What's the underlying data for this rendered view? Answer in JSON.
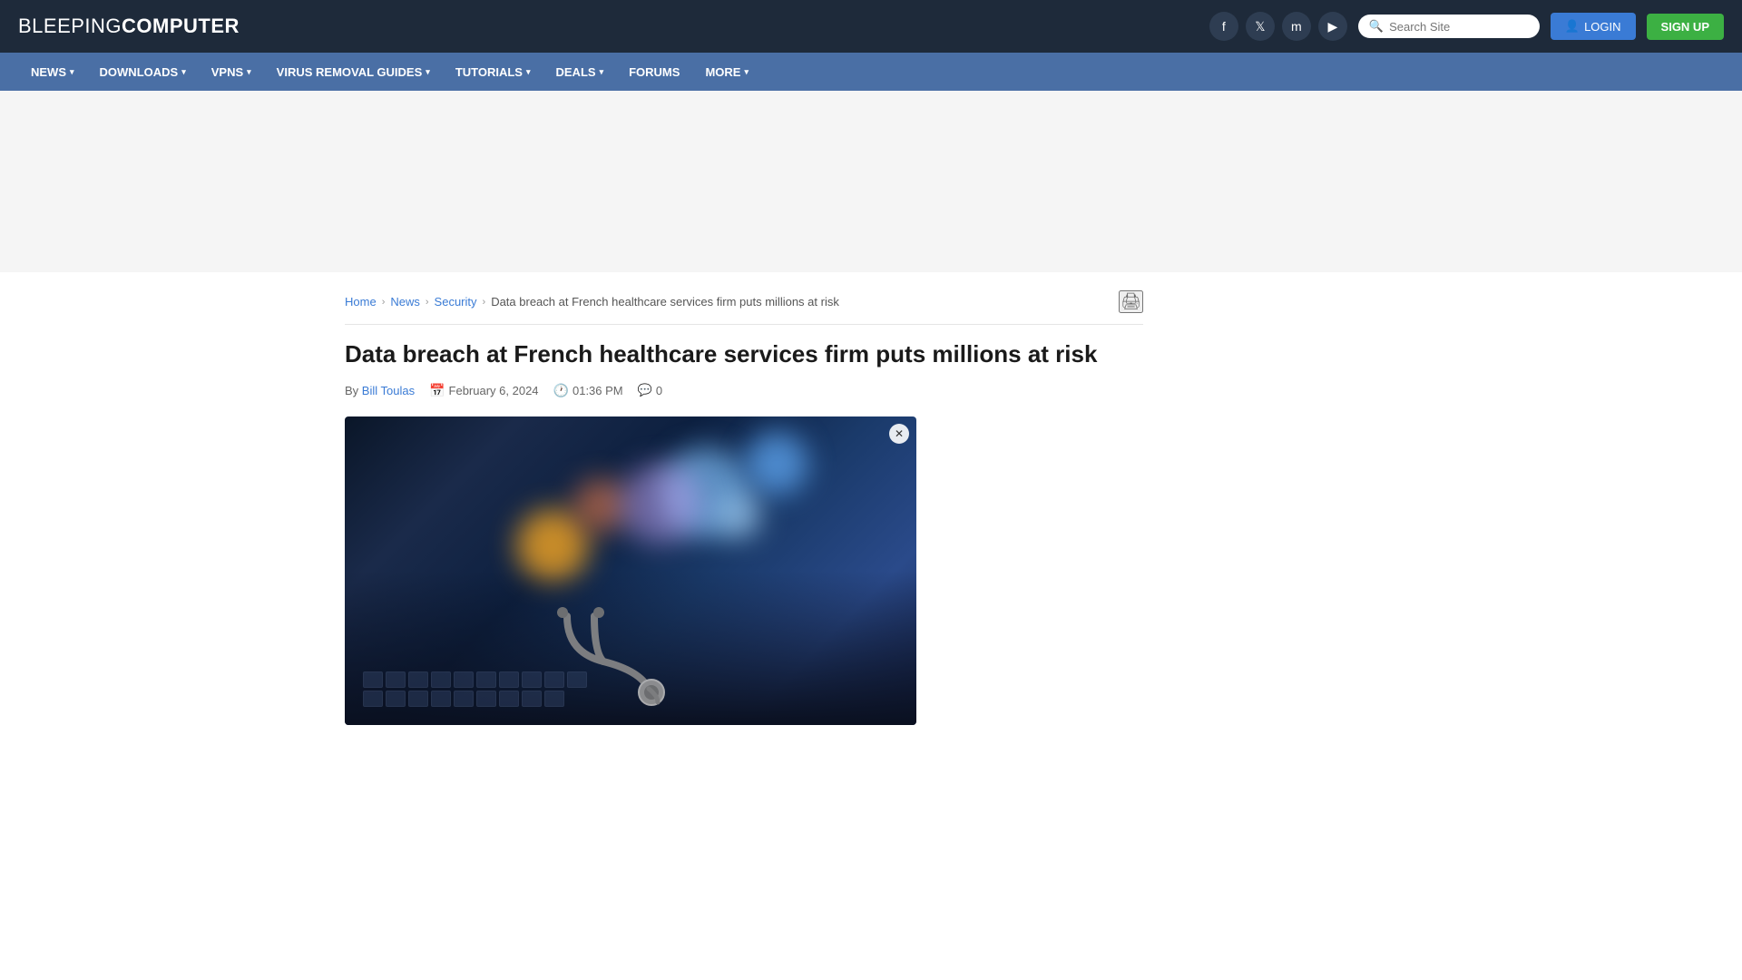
{
  "site": {
    "logo_light": "BLEEPING",
    "logo_bold": "COMPUTER",
    "url": "https://www.bleepingcomputer.com"
  },
  "header": {
    "search_placeholder": "Search Site",
    "login_label": "LOGIN",
    "signup_label": "SIGN UP",
    "social": [
      {
        "name": "facebook",
        "icon": "f"
      },
      {
        "name": "twitter",
        "icon": "𝕏"
      },
      {
        "name": "mastodon",
        "icon": "m"
      },
      {
        "name": "youtube",
        "icon": "▶"
      }
    ]
  },
  "nav": {
    "items": [
      {
        "label": "NEWS",
        "has_dropdown": true
      },
      {
        "label": "DOWNLOADS",
        "has_dropdown": true
      },
      {
        "label": "VPNS",
        "has_dropdown": true
      },
      {
        "label": "VIRUS REMOVAL GUIDES",
        "has_dropdown": true
      },
      {
        "label": "TUTORIALS",
        "has_dropdown": true
      },
      {
        "label": "DEALS",
        "has_dropdown": true
      },
      {
        "label": "FORUMS",
        "has_dropdown": false
      },
      {
        "label": "MORE",
        "has_dropdown": true
      }
    ]
  },
  "breadcrumb": {
    "home": "Home",
    "news": "News",
    "security": "Security",
    "current": "Data breach at French healthcare services firm puts millions at risk"
  },
  "article": {
    "title": "Data breach at French healthcare services firm puts millions at risk",
    "author": "Bill Toulas",
    "date": "February 6, 2024",
    "time": "01:36 PM",
    "comments": "0",
    "image_alt": "Healthcare data breach - stethoscope on laptop keyboard"
  },
  "icons": {
    "calendar": "📅",
    "clock": "🕐",
    "comment": "💬",
    "print": "🖨",
    "user": "👤",
    "search": "🔍"
  },
  "colors": {
    "header_bg": "#1e2a3a",
    "nav_bg": "#4a6fa5",
    "accent_blue": "#3a7bd5",
    "accent_green": "#3cb043",
    "link_color": "#3a7bd5"
  }
}
